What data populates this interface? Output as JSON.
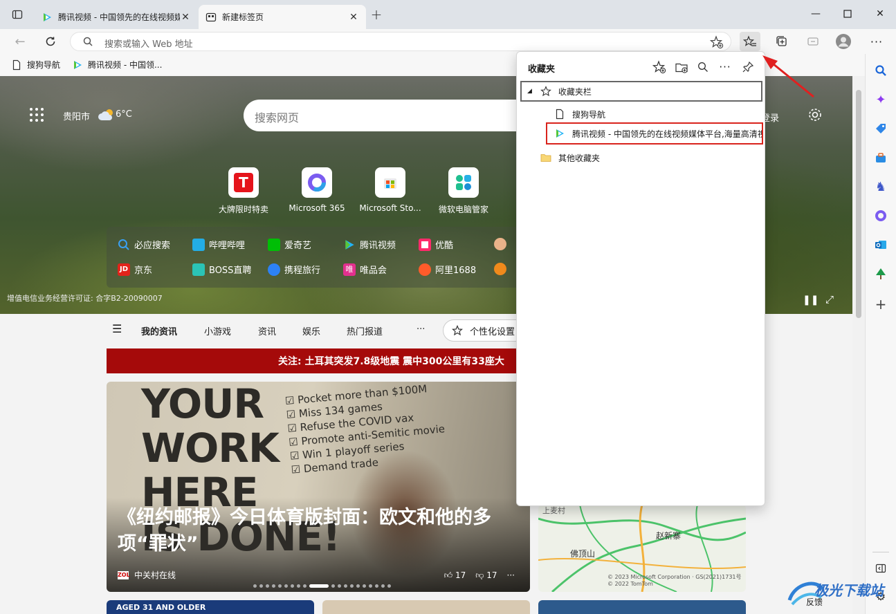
{
  "tabs": [
    {
      "title": "腾讯视频 - 中国领先的在线视频媒体平台,海量高清视频在线观看",
      "active": false
    },
    {
      "title": "新建标签页",
      "active": true
    }
  ],
  "address_bar": {
    "placeholder": "搜索或输入 Web 地址"
  },
  "bookmarks_bar": [
    {
      "label": "搜狗导航"
    },
    {
      "label": "腾讯视频 - 中国领..."
    }
  ],
  "ntp": {
    "location": "贵阳市",
    "temperature": "6°C",
    "search_placeholder": "搜索网页",
    "login": "登录",
    "quick_links": [
      {
        "label": "大牌限时特卖"
      },
      {
        "label": "Microsoft 365"
      },
      {
        "label": "Microsoft Sto..."
      },
      {
        "label": "微软电脑管家"
      }
    ],
    "site_links_row1": [
      "必应搜索",
      "哔哩哔哩",
      "爱奇艺",
      "腾讯视频",
      "优酷"
    ],
    "site_links_row2": [
      "京东",
      "BOSS直聘",
      "携程旅行",
      "唯品会",
      "阿里1688"
    ],
    "license": "增值电信业务经营许可证: 合字B2-20090007",
    "feed_tabs": [
      "我的资讯",
      "小游戏",
      "资讯",
      "娱乐",
      "热门报道",
      "···"
    ],
    "personalize": "个性化设置",
    "breaking_news": "关注: 土耳其突发7.8级地震 震中300公里有33座大",
    "main_story": {
      "headline": "《纽约邮报》今日体育版封面：欧文和他的多项“罪状”",
      "source": "中关村在线",
      "likes": "17",
      "dislikes": "17",
      "paper_big": [
        "YOUR",
        "WORK",
        "HERE",
        "IS DONE!"
      ],
      "paper_list": [
        "Pocket more than $100M",
        "Miss 134 games",
        "Refuse the COVID vax",
        "Promote anti-Semitic movie",
        "Win 1 playoff series",
        "Demand trade"
      ]
    },
    "map": {
      "places": [
        "上麦村",
        "赵新寨",
        "佛顶山"
      ],
      "copyright": "© 2023 Microsoft Corporation · GS(2021)1731号 © 2022 TomTom"
    },
    "bottom_card": "AGED 31 AND OLDER",
    "feedback": "反馈"
  },
  "favorites_panel": {
    "title": "收藏夹",
    "root_folder": "收藏夹栏",
    "items": [
      {
        "label": "搜狗导航"
      },
      {
        "label": "腾讯视频 - 中国领先的在线视频媒体平台,海量高清视频在线观看"
      }
    ],
    "other_folder": "其他收藏夹"
  },
  "watermark": "极光下载站",
  "colors": {
    "highlight_box": "#d9231c",
    "annotation_arrow": "#e02020",
    "breaking_bg": "#a50a0a"
  }
}
